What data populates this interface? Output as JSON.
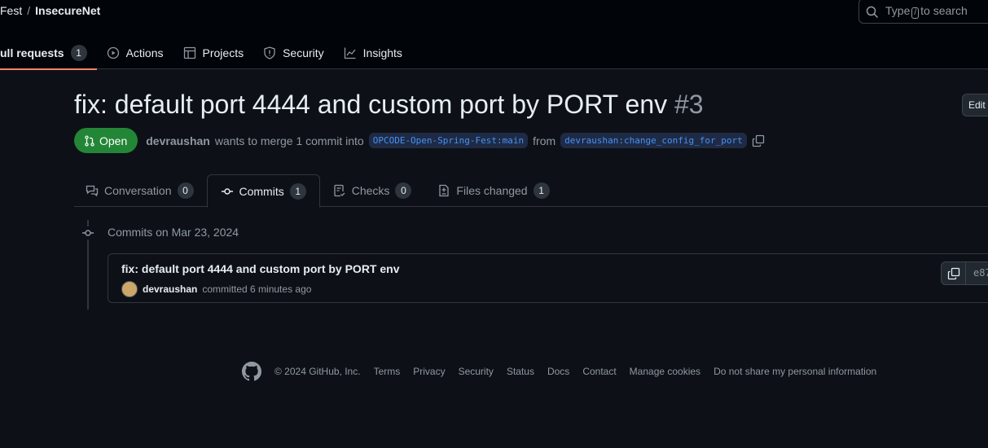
{
  "header": {
    "owner_partial": "Fest",
    "repo": "InsecureNet",
    "search_prefix": "Type",
    "search_key": "/",
    "search_suffix": "to search"
  },
  "nav": [
    {
      "label": "ull requests",
      "count": "1"
    },
    {
      "label": "Actions"
    },
    {
      "label": "Projects"
    },
    {
      "label": "Security"
    },
    {
      "label": "Insights"
    }
  ],
  "pr": {
    "title": "fix: default port 4444 and custom port by PORT env",
    "number": "#3",
    "edit_label": "Edit",
    "state": "Open",
    "author": "devraushan",
    "merge_text": "wants to merge 1 commit into",
    "base": "OPCODE-Open-Spring-Fest:main",
    "from": "from",
    "head": "devraushan:change_config_for_port"
  },
  "tabs": [
    {
      "label": "Conversation",
      "count": "0"
    },
    {
      "label": "Commits",
      "count": "1"
    },
    {
      "label": "Checks",
      "count": "0"
    },
    {
      "label": "Files changed",
      "count": "1"
    }
  ],
  "commits": {
    "date_label": "Commits on Mar 23, 2024",
    "items": [
      {
        "message": "fix: default port 4444 and custom port by PORT env",
        "author": "devraushan",
        "when": "committed 6 minutes ago",
        "sha": "e87"
      }
    ]
  },
  "footer": {
    "copyright": "© 2024 GitHub, Inc.",
    "links": [
      "Terms",
      "Privacy",
      "Security",
      "Status",
      "Docs",
      "Contact",
      "Manage cookies",
      "Do not share my personal information"
    ]
  }
}
